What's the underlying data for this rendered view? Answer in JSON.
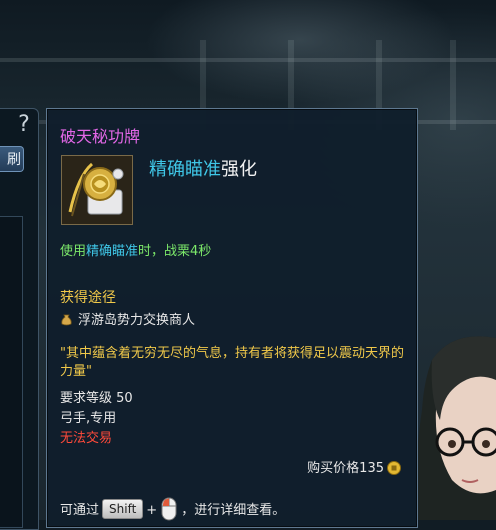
{
  "left_panel": {
    "help_label": "?",
    "tab_label": "刷"
  },
  "tooltip": {
    "item_name": "破天秘功牌",
    "skill_name": "精确瞄准",
    "skill_suffix": "强化",
    "effect": {
      "prefix": "使用",
      "skill": "精确瞄准",
      "suffix": "时，战栗4秒"
    },
    "source_title": "获得途径",
    "source_vendor": "浮游岛势力交换商人",
    "quote": "\"其中蕴含着无穷无尽的气息，持有者将获得足以震动天界的力量\"",
    "level_req": "要求等级 50",
    "class_req": "弓手,专用",
    "trade": "无法交易",
    "price": "购买价格135",
    "hint": {
      "prefix": "可通过",
      "key": "Shift",
      "plus": "+",
      "suffix": "，进行详细查看。"
    }
  },
  "colors": {
    "item_name": "#e267e6",
    "skill": "#3fc6e6",
    "effect": "#7ce86a",
    "gold_text": "#f1c94a",
    "trade_red": "#ff4a3a",
    "tooltip_bg": "#101e2c",
    "tooltip_border": "#5e7890"
  },
  "icons": [
    "item-plaque-icon",
    "money-bag-icon",
    "coin-icon",
    "mouse-icon",
    "help-icon"
  ]
}
